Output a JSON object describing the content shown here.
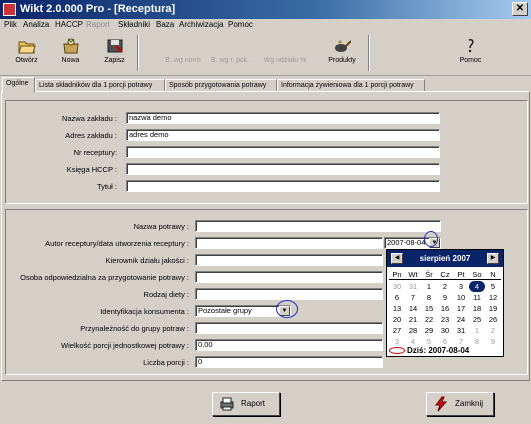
{
  "window": {
    "title": "Wikt 2.0.000 Pro - [Receptura]",
    "close_label": "✕"
  },
  "menu": [
    {
      "label": "Plik",
      "disabled": false
    },
    {
      "label": "Analiza",
      "disabled": false
    },
    {
      "label": "HACCP",
      "disabled": false
    },
    {
      "label": "Raport",
      "disabled": true
    },
    {
      "label": "Składniki",
      "disabled": false
    },
    {
      "label": "Baza",
      "disabled": false
    },
    {
      "label": "Archiwizacja",
      "disabled": false
    },
    {
      "label": "Pomoc",
      "disabled": false
    }
  ],
  "toolbar": {
    "open": "Otwórz",
    "new": "Nowa",
    "save": "Zapisz",
    "by_norm": "B. wg norm",
    "by_pck": "B. wg r. pck.",
    "by_share": "Wg udziału %",
    "products": "Produkty",
    "help": "Pomoc"
  },
  "tabs": [
    "Ogólne",
    "Lista składników dla 1 porcji potrawy",
    "Sposób przygotowania potrawy",
    "Informacja żywieniowa dla 1 porcji potrawy"
  ],
  "establishment": {
    "name_label": "Nazwa zakładu :",
    "name_value": "nazwa demo",
    "address_label": "Adres zakładu :",
    "address_value": "adres demo",
    "recipe_no_label": "Nr receptury:",
    "recipe_no_value": "",
    "haccp_book_label": "Księga HCCP :",
    "haccp_book_value": "",
    "title_label": "Tytuł :",
    "title_value": ""
  },
  "dish": {
    "name_label": "Nazwa potrawy :",
    "name_value": "",
    "author_label": "Autor receptury/data utworzenia receptury :",
    "author_value": "",
    "date_value": "2007-08-04",
    "quality_label": "Kierownik działu jakości :",
    "quality_value": "",
    "preparer_label": "Osoba odpowiedzialna za przygotowanie potrawy :",
    "preparer_value": "",
    "diet_label": "Rodzaj diety :",
    "diet_value": "",
    "consumer_label": "Identyfikacja konsumenta :",
    "consumer_value": "Pozostałe grupy",
    "group_label": "Przynależność do grupy potraw :",
    "group_value": "",
    "portion_size_label": "Wielkość porcji jednostkowej potrawy :",
    "portion_size_value": "0,00",
    "portions_label": "Liczba porcji :",
    "portions_value": "0"
  },
  "calendar": {
    "month": "sierpień 2007",
    "prev": "◀",
    "next": "▶",
    "dows": [
      "Pn",
      "Wt",
      "Śr",
      "Cz",
      "Pt",
      "So",
      "N"
    ],
    "weeks": [
      [
        {
          "d": "30",
          "o": true
        },
        {
          "d": "31",
          "o": true
        },
        {
          "d": "1"
        },
        {
          "d": "2"
        },
        {
          "d": "3"
        },
        {
          "d": "4",
          "s": true
        },
        {
          "d": "5"
        }
      ],
      [
        {
          "d": "6"
        },
        {
          "d": "7"
        },
        {
          "d": "8"
        },
        {
          "d": "9"
        },
        {
          "d": "10"
        },
        {
          "d": "11"
        },
        {
          "d": "12"
        }
      ],
      [
        {
          "d": "13"
        },
        {
          "d": "14"
        },
        {
          "d": "15"
        },
        {
          "d": "16"
        },
        {
          "d": "17"
        },
        {
          "d": "18"
        },
        {
          "d": "19"
        }
      ],
      [
        {
          "d": "20"
        },
        {
          "d": "21"
        },
        {
          "d": "22"
        },
        {
          "d": "23"
        },
        {
          "d": "24"
        },
        {
          "d": "25"
        },
        {
          "d": "26"
        }
      ],
      [
        {
          "d": "27"
        },
        {
          "d": "28"
        },
        {
          "d": "29"
        },
        {
          "d": "30"
        },
        {
          "d": "31"
        },
        {
          "d": "1",
          "o": true
        },
        {
          "d": "2",
          "o": true
        }
      ],
      [
        {
          "d": "3",
          "o": true
        },
        {
          "d": "4",
          "o": true
        },
        {
          "d": "5",
          "o": true
        },
        {
          "d": "6",
          "o": true
        },
        {
          "d": "7",
          "o": true
        },
        {
          "d": "8",
          "o": true
        },
        {
          "d": "9",
          "o": true
        }
      ]
    ],
    "today_label": "Dziś: 2007-08-04"
  },
  "buttons": {
    "report": "Raport",
    "close": "Zamknij"
  },
  "colors": {
    "title_bar": "#0a246a",
    "calendar_header": "#0a246a",
    "highlight_ring": "#1d2fd0",
    "today_ring": "#dd0000"
  }
}
